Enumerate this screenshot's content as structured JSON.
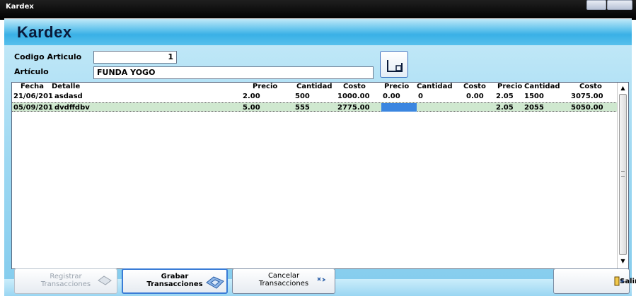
{
  "window": {
    "title": "Kardex"
  },
  "header": {
    "title": "Kardex"
  },
  "form": {
    "codigo_label": "Codigo Articulo",
    "codigo_value": "1",
    "articulo_label": "Artículo",
    "articulo_value": "FUNDA YOGO"
  },
  "table": {
    "columns": [
      "Fecha",
      "Detalle",
      "Precio",
      "Cantidad",
      "Costo",
      "Precio",
      "Cantidad",
      "Costo",
      "Precio",
      "Cantidad",
      "Costo"
    ],
    "rows": [
      {
        "fecha": "21/06/201",
        "detalle": "asdasd",
        "c1_precio": "2.00",
        "c1_cantidad": "500",
        "c1_costo": "1000.00",
        "c2_precio": "0.00",
        "c2_cantidad": "0",
        "c2_costo": "0.00",
        "c3_precio": "2.05",
        "c3_cantidad": "1500",
        "c3_costo": "3075.00",
        "selected": false
      },
      {
        "fecha": "05/09/201",
        "detalle": "dvdffdbv",
        "c1_precio": "5.00",
        "c1_cantidad": "555",
        "c1_costo": "2775.00",
        "c2_precio": "",
        "c2_cantidad": "",
        "c2_costo": "",
        "c3_precio": "2.05",
        "c3_cantidad": "2055",
        "c3_costo": "5050.00",
        "selected": true
      }
    ]
  },
  "footer": {
    "registrar_line1": "Registrar",
    "registrar_line2": "Transacciones",
    "grabar_line1": "Grabar",
    "grabar_line2": "Transacciones",
    "cancelar_line1": "Cancelar",
    "cancelar_line2": "Transacciones",
    "salir_label": "Salir"
  },
  "colors": {
    "header_accent": "#39b0e6",
    "selected_row": "#cfe8cf",
    "selected_cell": "#3b86e0"
  }
}
